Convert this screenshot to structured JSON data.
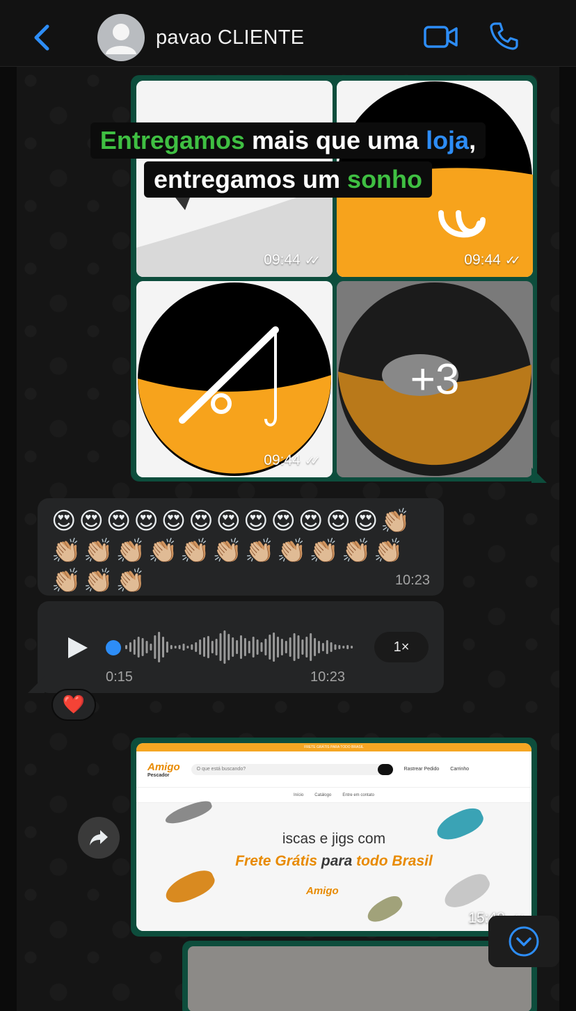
{
  "header": {
    "contact_name": "pavao CLIENTE",
    "accent_color": "#2d8df7"
  },
  "media_grid": {
    "caption": {
      "line1_part1": "Entregamos",
      "line1_part2": " mais que uma ",
      "line1_part3": "loja",
      "line1_part4": ",",
      "line2_part1": "entregamos um ",
      "line2_part2": "sonho"
    },
    "tiles": [
      {
        "time": "09:44"
      },
      {
        "time": "09:44"
      },
      {
        "time": "09:44"
      },
      {
        "overlay": "+3"
      }
    ],
    "bubble_color": "#0d4d3c"
  },
  "emoji_message": {
    "text": "😍😍😍😍😍😍😍😍😍😍😍😍👏🏼👏🏼👏🏼👏🏼👏🏼👏🏼👏🏼👏🏼👏🏼👏🏼👏🏼👏🏼👏🏼👏🏼👏🏼",
    "time": "10:23"
  },
  "audio_message": {
    "duration": "0:15",
    "time": "10:23",
    "speed": "1×",
    "reaction": "❤️"
  },
  "link_preview": {
    "topbar": "FRETE GRÁTIS PARA TODO BRASIL",
    "logo": "Amigo",
    "logo_sub": "Pescador",
    "search_placeholder": "O que está buscando?",
    "link_track": "Rastrear Pedido",
    "link_cart": "Carrinho",
    "nav": [
      "Início",
      "Catálogo",
      "Entre em contato"
    ],
    "hero_line1": "iscas e jigs com",
    "hero_line2_a": "Frete Grátis ",
    "hero_line2_b": "para",
    "hero_line2_c": " todo Brasil",
    "time": "15:48"
  }
}
